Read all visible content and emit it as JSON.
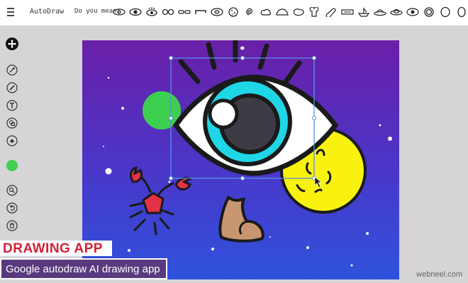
{
  "header": {
    "title": "AutoDraw",
    "suggest_label": "Do you mean:",
    "suggestions": [
      "eye-outline-icon",
      "eye-icon",
      "eye-lashes-icon",
      "glasses-icon",
      "sunglasses-icon",
      "brow-icon",
      "donut-icon",
      "cookie-icon",
      "swirl-icon",
      "cloud-icon",
      "mound-icon",
      "blob-icon",
      "toast-icon",
      "bread-icon",
      "bus-icon",
      "boat-icon",
      "ufo-icon",
      "saucer-icon",
      "target-eye-icon",
      "ring-icon",
      "egg-icon",
      "oval-icon"
    ]
  },
  "toolbar": {
    "tools": [
      "move-icon",
      "autodraw-icon",
      "draw-icon",
      "type-icon",
      "shape-icon",
      "fill-icon",
      "color-swatch",
      "zoom-icon",
      "undo-icon",
      "delete-icon"
    ],
    "color": "#3dcf4f"
  },
  "canvas": {
    "gradient_top": "#6a1fa8",
    "gradient_bottom": "#2f52dc",
    "selection_color": "#5b8ee6"
  },
  "overlay": {
    "banner_title": "DRAWING APP",
    "subtitle": "Google autodraw AI drawing app",
    "watermark": "webneel.com"
  }
}
